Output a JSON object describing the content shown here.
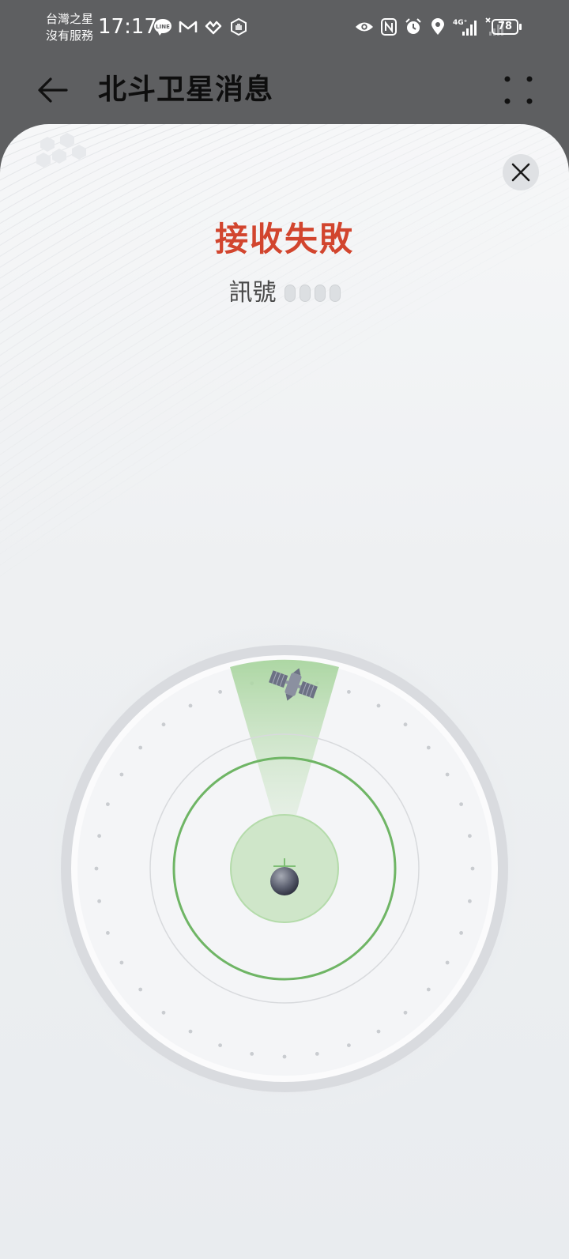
{
  "status_bar": {
    "carrier_line1": "台灣之星",
    "carrier_line2": "沒有服務",
    "time": "17:17",
    "network": "4G⁺",
    "battery": "78",
    "left_icons": [
      "line-icon",
      "mail-icon",
      "heart-rate-icon",
      "hand-icon"
    ],
    "right_icons": [
      "eye-icon",
      "nfc-icon",
      "alarm-icon",
      "location-icon",
      "signal-icon",
      "no-signal-icon"
    ]
  },
  "app_bar": {
    "title": "北斗卫星消息"
  },
  "dialog": {
    "status": "接收失敗",
    "signal_label": "訊號",
    "signal_level": 0,
    "signal_max": 4
  },
  "colors": {
    "status_error": "#d2452e",
    "ring_green": "#6fb565",
    "beam_green": "#b8dcb0",
    "statusbar_bg": "#5e5f61"
  }
}
